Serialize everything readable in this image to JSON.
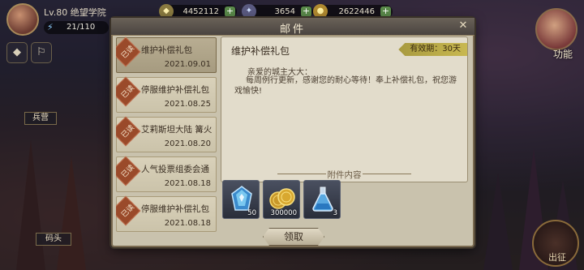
{
  "hud": {
    "level": "Lv.80",
    "title": "绝望学院",
    "energy": "21/110",
    "resources": [
      {
        "icon": "gem-icon",
        "value": "4452112"
      },
      {
        "icon": "crystal-icon",
        "value": "3654"
      },
      {
        "icon": "coin-icon",
        "value": "2622446"
      }
    ],
    "left_tags": [
      "兵营",
      "码头"
    ],
    "function_label": "功能",
    "go_label": "出征"
  },
  "mail": {
    "title": "邮件",
    "items": [
      {
        "tag": "已读",
        "subject": "维护补偿礼包",
        "date": "2021.09.01",
        "selected": true
      },
      {
        "tag": "已读",
        "subject": "停服维护补偿礼包",
        "date": "2021.08.25",
        "selected": false
      },
      {
        "tag": "已读",
        "subject": "艾莉斯坦大陆 篝火",
        "date": "2021.08.20",
        "selected": false
      },
      {
        "tag": "已读",
        "subject": "人气投票组委会通",
        "date": "2021.08.18",
        "selected": false
      },
      {
        "tag": "已读",
        "subject": "停服维护补偿礼包",
        "date": "2021.08.18",
        "selected": false
      }
    ],
    "detail": {
      "title": "维护补偿礼包",
      "validity": "有效期：30天",
      "greeting": "亲爱的城主大大：",
      "body": "每周例行更新，感谢您的耐心等待！奉上补偿礼包，祝您游戏愉快!",
      "attachments_label": "附件内容",
      "attachments": [
        {
          "icon": "blue-crystal-icon",
          "count": "50"
        },
        {
          "icon": "gold-coins-icon",
          "count": "300000"
        },
        {
          "icon": "potion-flask-icon",
          "count": "3"
        }
      ],
      "claim_label": "领取"
    }
  }
}
